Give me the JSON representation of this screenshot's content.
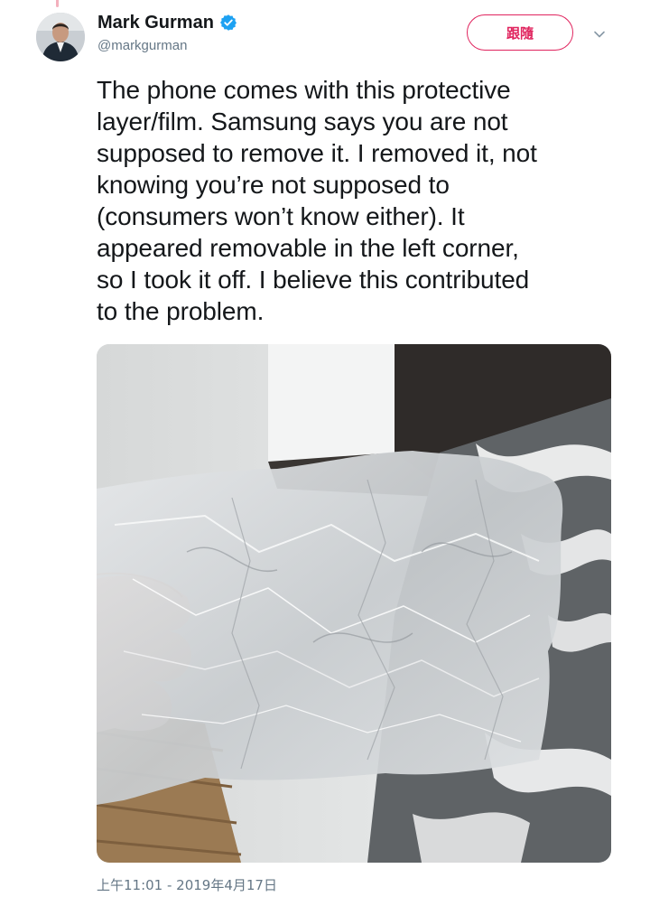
{
  "author": {
    "name": "Mark Gurman",
    "handle": "@markgurman",
    "verified": true
  },
  "actions": {
    "follow_label": "跟隨",
    "more_icon": "chevron-down-icon"
  },
  "tweet": {
    "text": "The phone comes with this protective\nlayer/film. Samsung says you are not\nsupposed to remove it. I removed it, not\nknowing you’re not supposed to\n(consumers won’t know either). It\nappeared removable in the left corner,\nso I took it off. I believe this contributed\nto the problem.",
    "timestamp": "上午11:01 - 2019年4月17日"
  },
  "colors": {
    "follow_accent": "#e0245e",
    "verified_blue": "#1da1f2",
    "secondary_text": "#657786",
    "primary_text": "#14171a"
  }
}
